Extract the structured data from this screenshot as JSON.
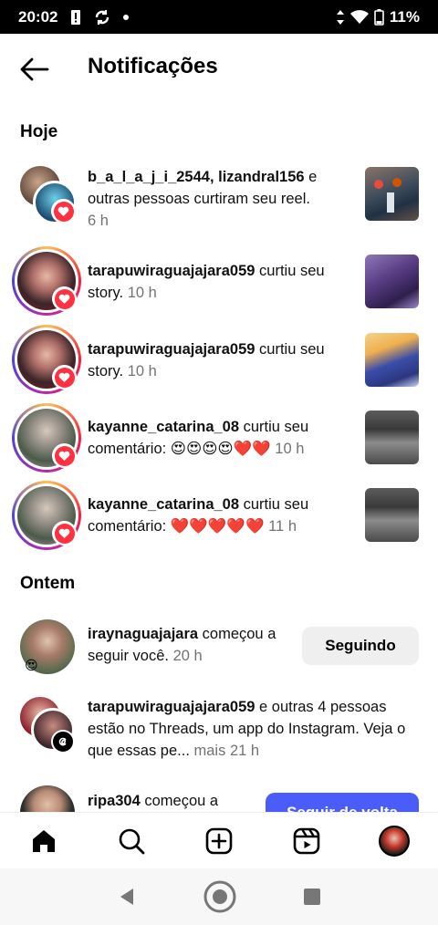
{
  "status_bar": {
    "time": "20:02",
    "battery": "11%"
  },
  "header": {
    "title": "Notificações"
  },
  "sections": {
    "today": "Hoje",
    "yesterday": "Ontem"
  },
  "notifications": [
    {
      "user": "b_a_l_a_j_i_2544",
      "sep": ", ",
      "user2": "lizandral156",
      "action": " e outras pessoas curtiram seu reel.",
      "time": "6 h"
    },
    {
      "user": "tarapuwiraguajajara059",
      "action": " curtiu seu story.",
      "time": "10 h"
    },
    {
      "user": "tarapuwiraguajajara059",
      "action": " curtiu seu story.",
      "time": "10 h"
    },
    {
      "user": "kayanne_catarina_08",
      "action": " curtiu seu comentário: 😍😍😍😍❤️❤️",
      "time": "10 h"
    },
    {
      "user": "kayanne_catarina_08",
      "action": " curtiu seu comentário: ❤️❤️❤️❤️❤️",
      "time": "11 h"
    },
    {
      "user": "iraynaguajajara",
      "action": " começou a seguir você.",
      "time": "20 h",
      "button": "Seguindo"
    },
    {
      "user": "tarapuwiraguajajara059",
      "action": " e outras 4 pessoas estão no Threads, um app do Instagram. Veja o que essas pe...",
      "more": " mais",
      "time": "21 h"
    },
    {
      "user": "ripa304",
      "action": " começou a",
      "button": "Seguir de volta"
    }
  ],
  "colors": {
    "accent": "#4a5df9",
    "like": "#ff3040"
  },
  "nav": [
    "home-icon",
    "search-icon",
    "create-icon",
    "reels-icon",
    "profile-avatar"
  ]
}
